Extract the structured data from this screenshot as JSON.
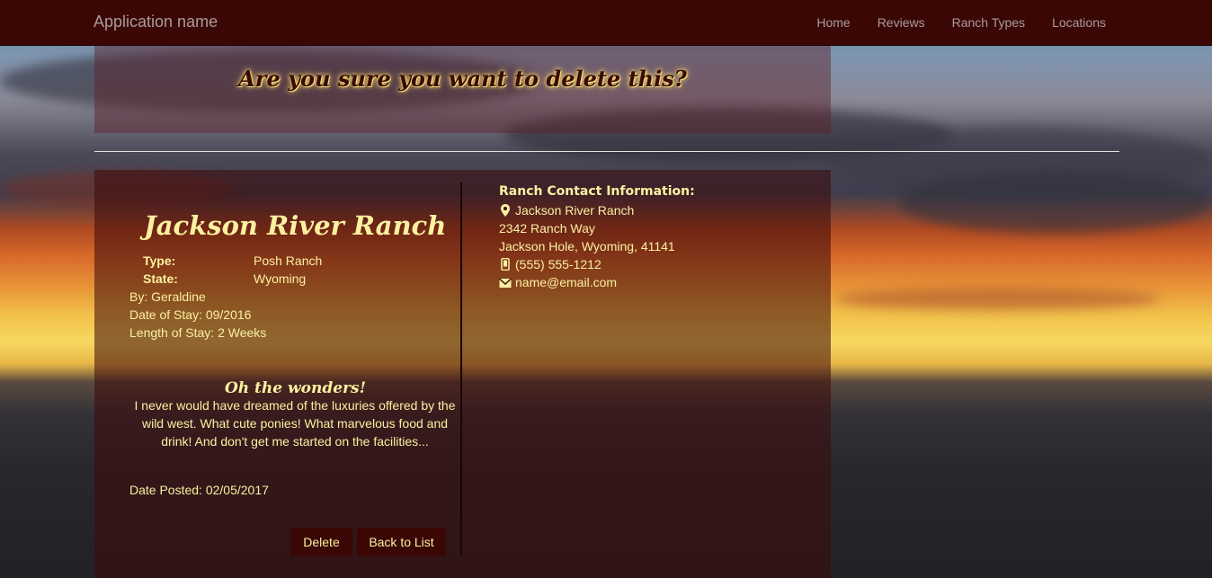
{
  "nav": {
    "brand": "Application name",
    "links": [
      "Home",
      "Reviews",
      "Ranch Types",
      "Locations"
    ]
  },
  "page": {
    "heading": "Are you sure you want to delete this?"
  },
  "review": {
    "ranch_name": "Jackson River Ranch",
    "type_label": "Type:",
    "type_value": "Posh Ranch",
    "state_label": "State:",
    "state_value": "Wyoming",
    "by": "By: Geraldine",
    "date_of_stay": "Date of Stay: 09/2016",
    "length_of_stay": "Length of Stay: 2 Weeks",
    "title": "Oh the wonders!",
    "body": "I never would have dreamed of the luxuries offered by the wild west. What cute ponies! What marvelous food and drink! And don't get me started on the facilities...",
    "date_posted": "Date Posted: 02/05/2017"
  },
  "contact": {
    "title": "Ranch Contact Information:",
    "name": "Jackson River Ranch",
    "address1": "2342 Ranch Way",
    "address2": "Jackson Hole, Wyoming, 41141",
    "phone": "(555) 555-1212",
    "email": "name@email.com"
  },
  "actions": {
    "delete": "Delete",
    "back": "Back to List"
  },
  "colors": {
    "navbar": "#3a0705",
    "text": "#fbf0a0"
  }
}
